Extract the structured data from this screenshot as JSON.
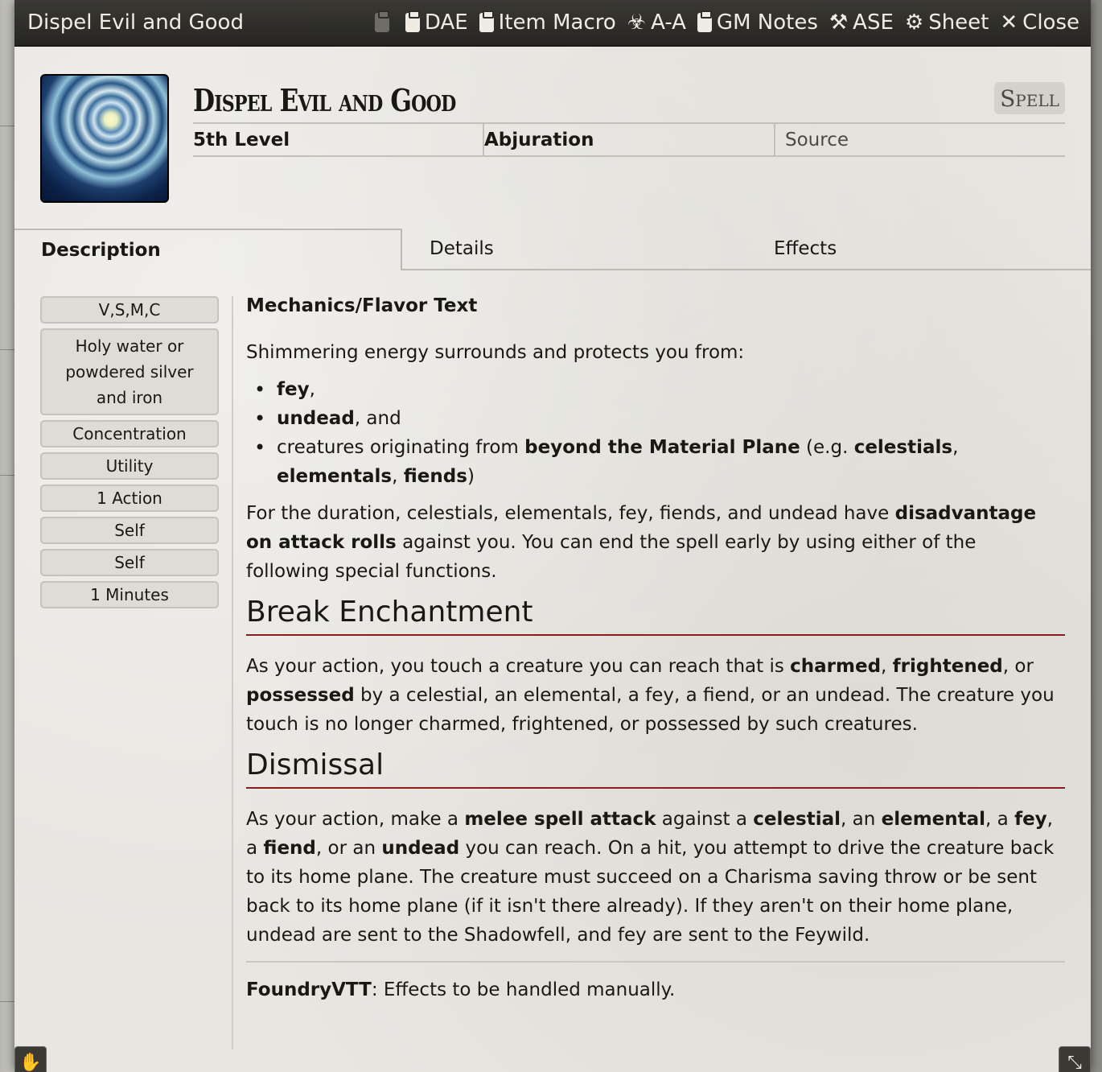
{
  "window": {
    "title": "Dispel Evil and Good"
  },
  "header_buttons": [
    {
      "label": "DAE",
      "icon": "clipboard-icon"
    },
    {
      "label": "Item Macro",
      "icon": "clipboard-icon"
    },
    {
      "label": "A-A",
      "icon": "biohazard-icon"
    },
    {
      "label": "GM Notes",
      "icon": "clipboard-icon"
    },
    {
      "label": "ASE",
      "icon": "magic-wand-icon"
    },
    {
      "label": "Sheet",
      "icon": "gear-icon"
    },
    {
      "label": "Close",
      "icon": "close-icon"
    }
  ],
  "item": {
    "name": "Dispel Evil and Good",
    "type": "Spell",
    "level": "5th Level",
    "school": "Abjuration",
    "source": "Source"
  },
  "tabs": [
    "Description",
    "Details",
    "Effects"
  ],
  "properties": [
    "V,S,M,C",
    "Holy water or powdered silver and iron",
    "Concentration",
    "Utility",
    "1 Action",
    "Self",
    "Self",
    "1 Minutes"
  ],
  "description": {
    "heading": "Mechanics/Flavor Text",
    "intro": "Shimmering energy surrounds and protects you from:",
    "list": {
      "fey": "fey",
      "fey_tail": ",",
      "undead": "undead",
      "undead_tail": ", and",
      "c_pre": "creatures originating from ",
      "c_beyond": "beyond the Material Plane",
      "c_mid": " (e.g. ",
      "c_celestials": "celestials",
      "c_sep1": ", ",
      "c_elementals": "elementals",
      "c_sep2": ", ",
      "c_fiends": "fiends",
      "c_end": ")"
    },
    "p_duration": {
      "a": "For the duration, celestials, elementals, fey, fiends, and undead have ",
      "b": "disadvantage on attack rolls",
      "c": " against you. You can end the spell early by using either of the following special functions."
    },
    "break_title": "Break Enchantment",
    "p_break": {
      "a": "As your action, you touch a creature you can reach that is ",
      "charmed": "charmed",
      "s1": ", ",
      "frightened": "frightened",
      "s2": ", or ",
      "possessed": "possessed",
      "b": " by a celestial, an elemental, a fey, a fiend, or an undead. The creature you touch is no longer charmed, frightened, or possessed by such creatures."
    },
    "dismissal_title": "Dismissal",
    "p_dismissal": {
      "a": "As your action, make a ",
      "melee": "melee spell attack",
      "b": " against a ",
      "celestial": "celestial",
      "c": ", an ",
      "elemental": "elemental",
      "d": ", a ",
      "fey": "fey",
      "e": ", a ",
      "fiend": "fiend",
      "f": ", or an ",
      "undead": "undead",
      "g": " you can reach. On a hit, you attempt to drive the creature back to its home plane. The creature must succeed on a Charisma saving throw or be sent back to its home plane (if it isn't there already). If they aren't on their home plane, undead are sent to the Shadowfell, and fey are sent to the Feywild."
    },
    "footer_label": "FoundryVTT",
    "footer_text": ": Effects to be handled manually."
  },
  "colors": {
    "titlebar": "#2e2d29",
    "heading_rule": "#8b1c1c",
    "sheet_bg": "#e8e6e1"
  }
}
